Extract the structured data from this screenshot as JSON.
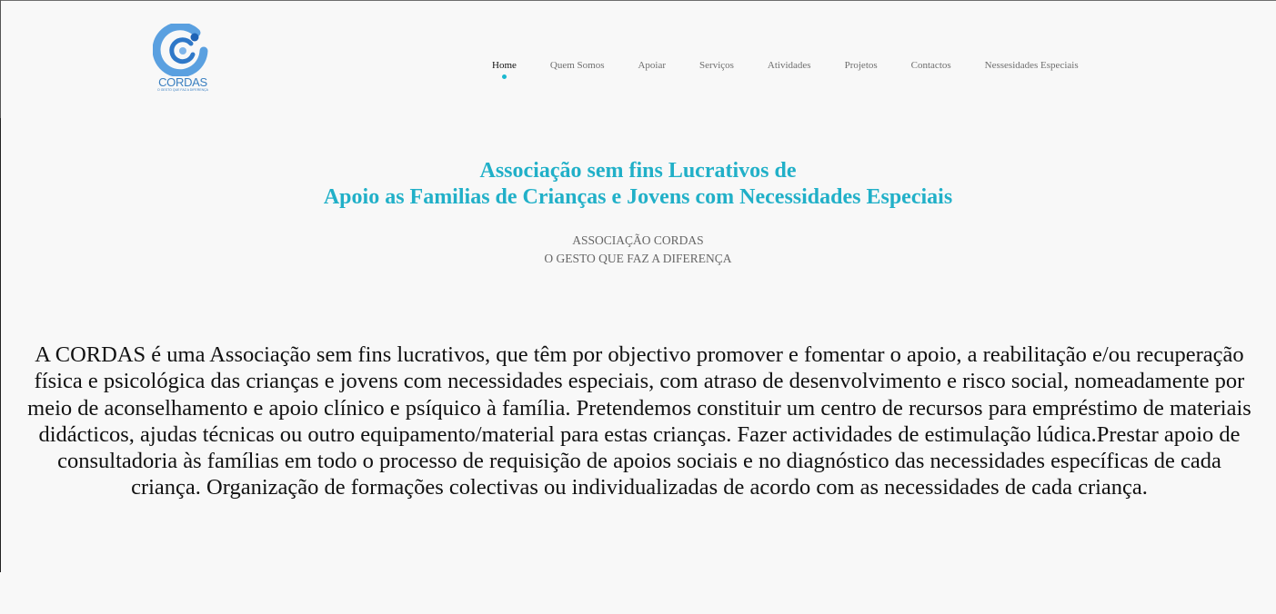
{
  "logo": {
    "name": "CORDAS",
    "tagline": "O GESTO QUE FAZ A DIFERENÇA",
    "colors": {
      "primary": "#4a90d9",
      "light": "#7fb5ea",
      "dark": "#1e63b5"
    }
  },
  "nav": {
    "items": [
      {
        "label": "Home",
        "active": true
      },
      {
        "label": "Quem Somos"
      },
      {
        "label": "Apoiar"
      },
      {
        "label": "Serviços"
      },
      {
        "label": "Atividades"
      },
      {
        "label": "Projetos"
      },
      {
        "label": "Contactos"
      },
      {
        "label": "Nessesidades Especiais"
      }
    ],
    "active_indicator_color": "#1bb8cf"
  },
  "hero": {
    "title_line1": "Associação sem fins Lucrativos de",
    "title_line2": "Apoio as Familias de Crianças e Jovens com Necessidades Especiais",
    "title_color": "#21b0c8",
    "subtitle_line1": "ASSOCIAÇÃO CORDAS",
    "subtitle_line2": "O GESTO QUE FAZ A DIFERENÇA"
  },
  "main": {
    "description": "A CORDAS é uma Associação sem fins lucrativos, que têm por objectivo promover e fomentar o apoio, a reabilitação e/ou recuperação física e psicológica das crianças e jovens com necessidades especiais, com atraso de desenvolvimento e risco social, nomeadamente por meio de aconselhamento e apoio clínico e psíquico à família. Pretendemos constituir um centro de recursos para empréstimo de materiais didácticos, ajudas técnicas ou outro equipamento/material para estas crianças. Fazer actividades de estimulação lúdica.Prestar apoio de consultadoria às famílias em todo o processo de requisição de apoios sociais e no diagnóstico das necessidades específicas de cada criança. Organização de formações colectivas ou individualizadas de acordo com as necessidades de cada criança."
  }
}
